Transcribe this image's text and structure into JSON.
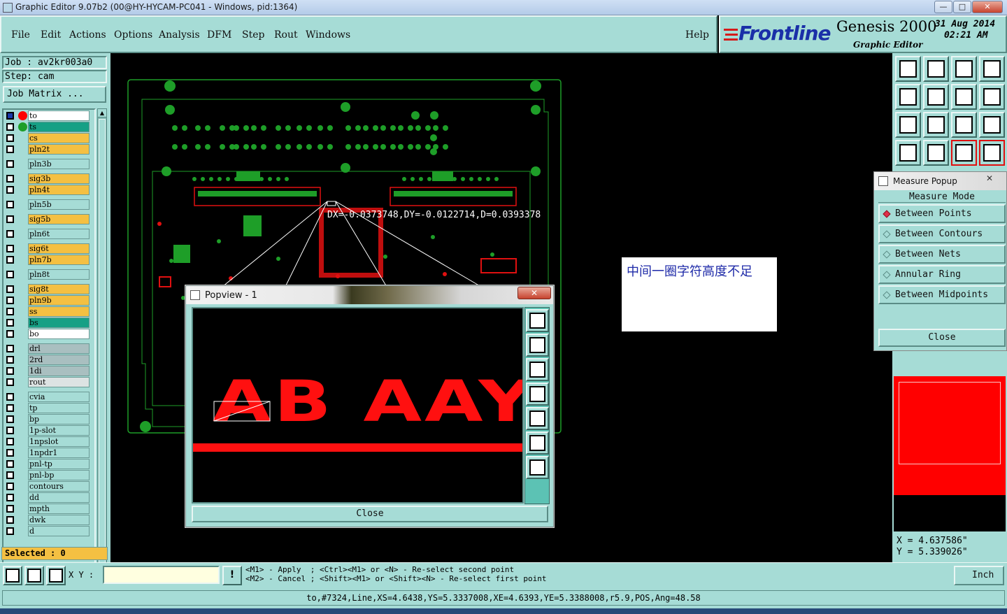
{
  "window": {
    "title": "Graphic Editor 9.07b2 (00@HY-HYCAM-PC041 - Windows, pid:1364)",
    "min": "—",
    "max": "□",
    "close": "✕"
  },
  "menu": [
    "File",
    "Edit",
    "Actions",
    "Options",
    "Analysis",
    "DFM",
    "Step",
    "Rout",
    "Windows"
  ],
  "help": "Help",
  "logo": {
    "brand": "Frontline",
    "product": "Genesis 2000",
    "subtitle": "Graphic Editor",
    "date": "31 Aug 2014",
    "time": "02:21 AM"
  },
  "job": {
    "job": "Job  : av2kr003a0",
    "step": "Step: cam",
    "matrix": "Job Matrix ..."
  },
  "layers": [
    {
      "name": "to",
      "color": "w"
    },
    {
      "name": "ts",
      "color": "g"
    },
    {
      "name": "cs",
      "color": "y"
    },
    {
      "name": "pln2t",
      "color": "y"
    },
    {
      "name": "pln3b",
      "color": "t"
    },
    {
      "name": "sig3b",
      "color": "y"
    },
    {
      "name": "pln4t",
      "color": "y"
    },
    {
      "name": "pln5b",
      "color": "t"
    },
    {
      "name": "sig5b",
      "color": "y"
    },
    {
      "name": "pln6t",
      "color": "t"
    },
    {
      "name": "sig6t",
      "color": "y"
    },
    {
      "name": "pln7b",
      "color": "y"
    },
    {
      "name": "pln8t",
      "color": "t"
    },
    {
      "name": "sig8t",
      "color": "y"
    },
    {
      "name": "pln9b",
      "color": "y"
    },
    {
      "name": "ss",
      "color": "y"
    },
    {
      "name": "bs",
      "color": "g"
    },
    {
      "name": "bo",
      "color": "w"
    },
    {
      "name": "drl",
      "color": "gr"
    },
    {
      "name": "2rd",
      "color": "gr"
    },
    {
      "name": "1di",
      "color": "gr"
    },
    {
      "name": "rout",
      "color": "lg"
    },
    {
      "name": "cvia",
      "color": "t"
    },
    {
      "name": "tp",
      "color": "t"
    },
    {
      "name": "bp",
      "color": "t"
    },
    {
      "name": "1p-slot",
      "color": "t"
    },
    {
      "name": "1npslot",
      "color": "t"
    },
    {
      "name": "1npdr1",
      "color": "t"
    },
    {
      "name": "pnl-tp",
      "color": "t"
    },
    {
      "name": "pnl-bp",
      "color": "t"
    },
    {
      "name": "contours",
      "color": "t"
    },
    {
      "name": "dd",
      "color": "t"
    },
    {
      "name": "mpth",
      "color": "t"
    },
    {
      "name": "dwk",
      "color": "t"
    },
    {
      "name": "d",
      "color": "t"
    }
  ],
  "selected": "Selected : 0",
  "measure_readout": "DX=-0.0373748,DY=-0.0122714,D=0.0393378",
  "annotation": "中间一圈字符高度不足",
  "popview": {
    "title": "Popview - 1",
    "close": "Close",
    "close_x": "✕",
    "text": "AB AAYM"
  },
  "measure": {
    "title": "Measure Popup",
    "mode": "Measure Mode",
    "options": [
      "Between Points",
      "Between Contours",
      "Between Nets",
      "Annular Ring",
      "Between Midpoints"
    ],
    "selected_index": 0,
    "close": "Close",
    "close_x": "✕"
  },
  "coords": {
    "x": "X  = 4.637586\"",
    "y": "Y  = 5.339026\""
  },
  "bottom": {
    "xy_label": "X Y :",
    "xy_value": "",
    "hint1": "<M1> - Apply  ; <Ctrl><M1> or <N> - Re-select second point",
    "hint2": "<M2> - Cancel ; <Shift><M1> or <Shift><N> - Re-select first point",
    "unit": "Inch"
  },
  "status": "to,#7324,Line,XS=4.6438,YS=5.3337008,XE=4.6393,YE=5.3388008,r5.9,POS,Ang=48.58",
  "colors": {
    "panel": "#a6dcd6",
    "pcb_green": "#1e9e28",
    "pcb_red": "#e01010",
    "highlight_red": "#ff0000"
  }
}
